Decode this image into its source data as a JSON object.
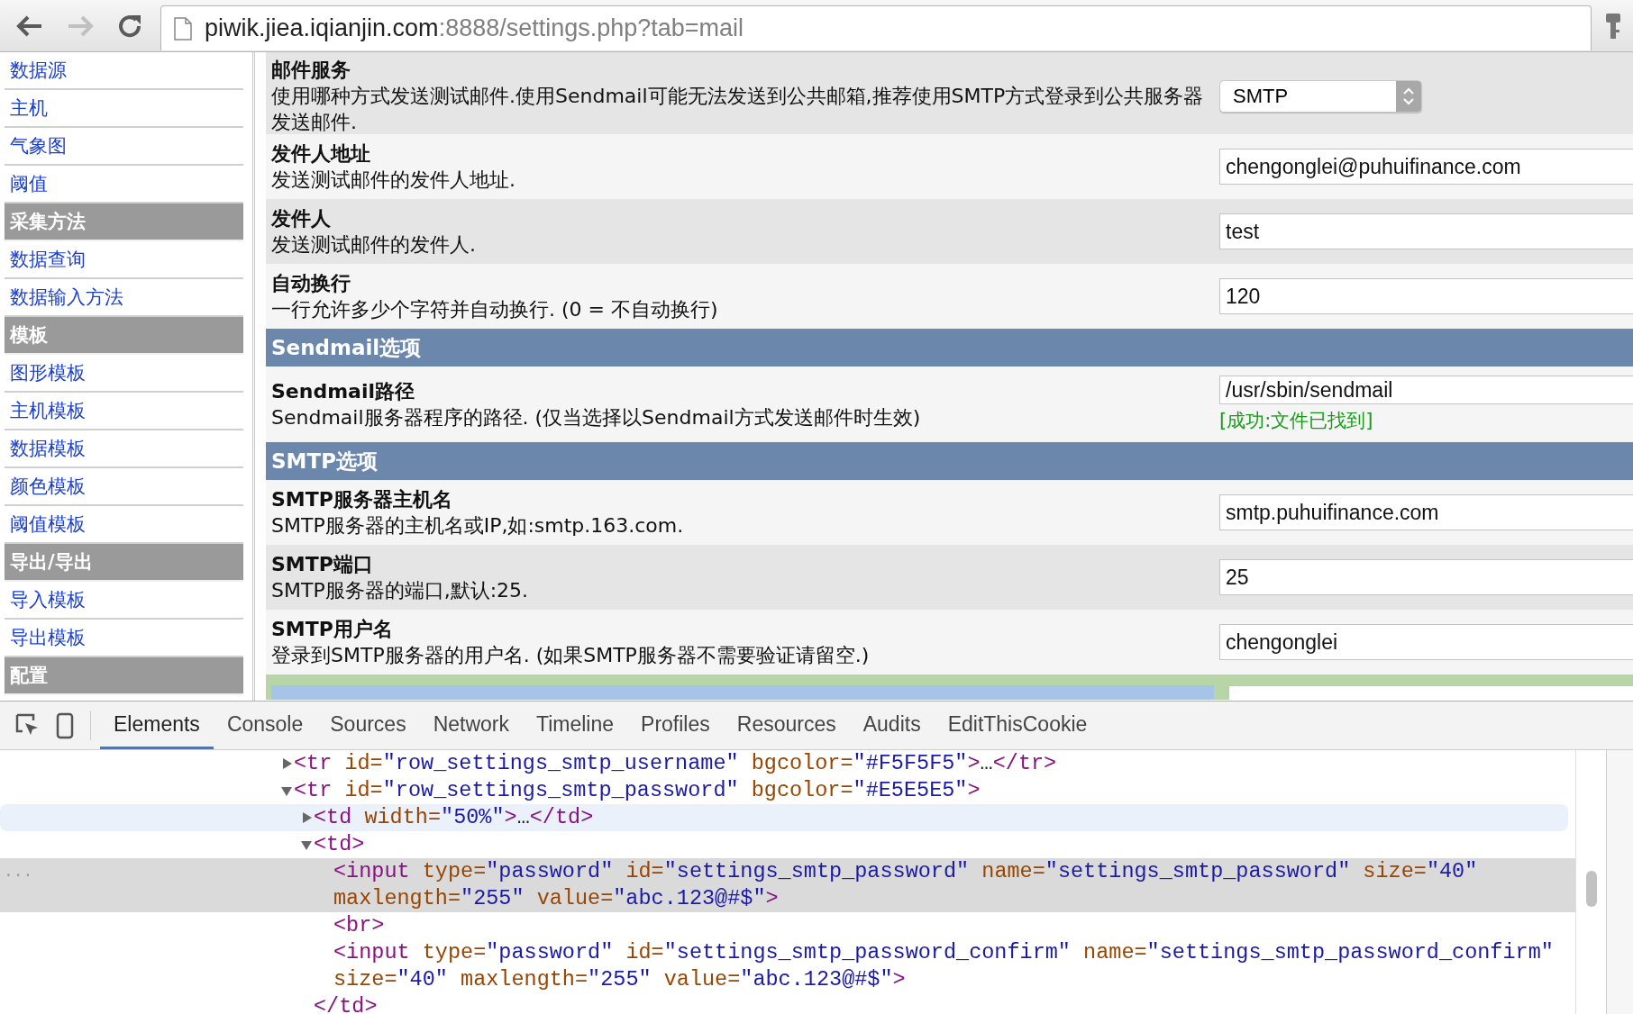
{
  "browser": {
    "url_host": "piwik.jiea.iqianjin.com",
    "url_rest": ":8888/settings.php?tab=mail",
    "forward_disabled": true
  },
  "sidebar": {
    "items": [
      {
        "kind": "link",
        "label": "数据源"
      },
      {
        "kind": "link",
        "label": "主机"
      },
      {
        "kind": "link",
        "label": "气象图"
      },
      {
        "kind": "link",
        "label": "阈值"
      },
      {
        "kind": "header",
        "label": "采集方法"
      },
      {
        "kind": "link",
        "label": "数据查询"
      },
      {
        "kind": "link",
        "label": "数据输入方法"
      },
      {
        "kind": "header",
        "label": "模板"
      },
      {
        "kind": "link",
        "label": "图形模板"
      },
      {
        "kind": "link",
        "label": "主机模板"
      },
      {
        "kind": "link",
        "label": "数据模板"
      },
      {
        "kind": "link",
        "label": "颜色模板"
      },
      {
        "kind": "link",
        "label": "阈值模板"
      },
      {
        "kind": "header",
        "label": "导出/导出"
      },
      {
        "kind": "link",
        "label": "导入模板"
      },
      {
        "kind": "link",
        "label": "导出模板"
      },
      {
        "kind": "header",
        "label": "配置"
      }
    ]
  },
  "settings": {
    "rows": [
      {
        "kind": "select",
        "color": "#e5e5e5",
        "title": "邮件服务",
        "description": "使用哪种方式发送测试邮件.使用Sendmail可能无法发送到公共邮箱,推荐使用SMTP方式登录到公共服务器发送邮件.",
        "value": "SMTP"
      },
      {
        "kind": "input",
        "color": "#f5f5f5",
        "title": "发件人地址",
        "description": "发送测试邮件的发件人地址.",
        "value": "chengonglei@puhuifinance.com"
      },
      {
        "kind": "input",
        "color": "#e5e5e5",
        "title": "发件人",
        "description": "发送测试邮件的发件人.",
        "value": "test"
      },
      {
        "kind": "input",
        "color": "#f5f5f5",
        "title": "自动换行",
        "description": "一行允许多少个字符并自动换行. (0 = 不自动换行)",
        "value": "120"
      },
      {
        "kind": "section",
        "title": "Sendmail选项"
      },
      {
        "kind": "input",
        "color": "#f5f5f5",
        "title": "Sendmail路径",
        "description": "Sendmail服务器程序的路径. (仅当选择以Sendmail方式发送邮件时生效)",
        "value": "/usr/sbin/sendmail",
        "note": "[成功:文件已找到]"
      },
      {
        "kind": "section",
        "title": "SMTP选项"
      },
      {
        "kind": "input",
        "color": "#f5f5f5",
        "title": "SMTP服务器主机名",
        "description": "SMTP服务器的主机名或IP,如:smtp.163.com.",
        "value": "smtp.puhuifinance.com"
      },
      {
        "kind": "input",
        "color": "#e5e5e5",
        "title": "SMTP端口",
        "description": "SMTP服务器的端口,默认:25.",
        "value": "25"
      },
      {
        "kind": "input",
        "color": "#f5f5f5",
        "title": "SMTP用户名",
        "description": "登录到SMTP服务器的用户名. (如果SMTP服务器不需要验证请留空.)",
        "value": "chengonglei"
      },
      {
        "kind": "cut",
        "highlighted": true
      }
    ]
  },
  "devtools": {
    "tabs": [
      {
        "label": "Elements",
        "selected": true
      },
      {
        "label": "Console",
        "selected": false
      },
      {
        "label": "Sources",
        "selected": false
      },
      {
        "label": "Network",
        "selected": false
      },
      {
        "label": "Timeline",
        "selected": false
      },
      {
        "label": "Profiles",
        "selected": false
      },
      {
        "label": "Resources",
        "selected": false
      },
      {
        "label": "Audits",
        "selected": false
      },
      {
        "label": "EditThisCookie",
        "selected": false
      }
    ],
    "tree": [
      {
        "expanded": false,
        "selected": false,
        "hovered": false,
        "tokens": [
          {
            "kind": "tag",
            "text": "<tr"
          },
          {
            "kind": "attr",
            "text": " id="
          },
          {
            "kind": "value",
            "text": "\"row_settings_smtp_username\""
          },
          {
            "kind": "attr",
            "text": " bgcolor="
          },
          {
            "kind": "value",
            "text": "\"#F5F5F5\""
          },
          {
            "kind": "tag",
            "text": ">"
          },
          {
            "kind": "plain",
            "text": "…"
          },
          {
            "kind": "tag",
            "text": "</tr>"
          }
        ]
      },
      {
        "expanded": true,
        "selected": false,
        "hovered": false,
        "tokens": [
          {
            "kind": "tag",
            "text": "<tr"
          },
          {
            "kind": "attr",
            "text": " id="
          },
          {
            "kind": "value",
            "text": "\"row_settings_smtp_password\""
          },
          {
            "kind": "attr",
            "text": " bgcolor="
          },
          {
            "kind": "value",
            "text": "\"#E5E5E5\""
          },
          {
            "kind": "tag",
            "text": ">"
          }
        ],
        "children": [
          {
            "expanded": false,
            "selected": false,
            "hovered": true,
            "tokens": [
              {
                "kind": "tag",
                "text": "<td"
              },
              {
                "kind": "attr",
                "text": " width="
              },
              {
                "kind": "value",
                "text": "\"50%\""
              },
              {
                "kind": "tag",
                "text": ">"
              },
              {
                "kind": "plain",
                "text": "…"
              },
              {
                "kind": "tag",
                "text": "</td>"
              }
            ]
          },
          {
            "expanded": true,
            "selected": false,
            "hovered": false,
            "tokens": [
              {
                "kind": "tag",
                "text": "<td>"
              }
            ],
            "closing": "</td>",
            "children": [
              {
                "selected": true,
                "hovered": false,
                "gutter": "...",
                "tokens": [
                  {
                    "kind": "tag",
                    "text": "<input"
                  },
                  {
                    "kind": "attr",
                    "text": " type="
                  },
                  {
                    "kind": "value",
                    "text": "\"password\""
                  },
                  {
                    "kind": "attr",
                    "text": " id="
                  },
                  {
                    "kind": "value",
                    "text": "\"settings_smtp_password\""
                  },
                  {
                    "kind": "attr",
                    "text": " name="
                  },
                  {
                    "kind": "value",
                    "text": "\"settings_smtp_password\""
                  },
                  {
                    "kind": "attr",
                    "text": " size="
                  },
                  {
                    "kind": "value",
                    "text": "\"40\""
                  },
                  {
                    "kind": "attr",
                    "text": " maxlength="
                  },
                  {
                    "kind": "value",
                    "text": "\"255\""
                  },
                  {
                    "kind": "attr",
                    "text": " value="
                  },
                  {
                    "kind": "value",
                    "text": "\"abc.123@#$\""
                  },
                  {
                    "kind": "tag",
                    "text": ">"
                  }
                ]
              },
              {
                "selected": false,
                "hovered": false,
                "tokens": [
                  {
                    "kind": "tag",
                    "text": "<br>"
                  }
                ]
              },
              {
                "selected": false,
                "hovered": false,
                "tokens": [
                  {
                    "kind": "tag",
                    "text": "<input"
                  },
                  {
                    "kind": "attr",
                    "text": " type="
                  },
                  {
                    "kind": "value",
                    "text": "\"password\""
                  },
                  {
                    "kind": "attr",
                    "text": " id="
                  },
                  {
                    "kind": "value",
                    "text": "\"settings_smtp_password_confirm\""
                  },
                  {
                    "kind": "attr",
                    "text": " name="
                  },
                  {
                    "kind": "value",
                    "text": "\"settings_smtp_password_confirm\""
                  },
                  {
                    "kind": "attr",
                    "text": " size="
                  },
                  {
                    "kind": "value",
                    "text": "\"40\""
                  },
                  {
                    "kind": "attr",
                    "text": " maxlength="
                  },
                  {
                    "kind": "value",
                    "text": "\"255\""
                  },
                  {
                    "kind": "attr",
                    "text": " value="
                  },
                  {
                    "kind": "value",
                    "text": "\"abc.123@#$\""
                  },
                  {
                    "kind": "tag",
                    "text": ">"
                  }
                ]
              }
            ]
          }
        ]
      }
    ]
  }
}
